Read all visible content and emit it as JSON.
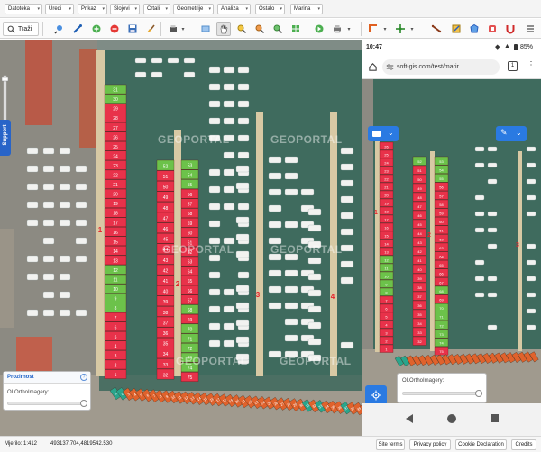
{
  "menubar": {
    "items": [
      {
        "label": "Datoteka"
      },
      {
        "label": "Uredi"
      },
      {
        "label": "Prikaz"
      },
      {
        "label": "Slojevi"
      },
      {
        "label": "Crtali"
      },
      {
        "label": "Geometrije"
      },
      {
        "label": "Analiza"
      },
      {
        "label": "Ostalo"
      },
      {
        "label": "Marina"
      }
    ]
  },
  "toolbar": {
    "search_label": "Traži",
    "icons": [
      "zoom-in-icon",
      "pencil-icon",
      "plus-icon",
      "minus-icon",
      "save-icon",
      "brush-icon",
      "print-icon",
      "rectangle-icon",
      "pan-icon",
      "search-zoom-icon",
      "zoom-out-icon",
      "zoom-extent-icon",
      "layers-icon",
      "arrow-icon",
      "printer-icon",
      "corner-icon",
      "crosshair-icon",
      "line-icon",
      "select-icon",
      "polygon-icon",
      "undo-icon",
      "redo-icon",
      "menu-icon"
    ]
  },
  "support_label": "Support",
  "map": {
    "watermark": "GEOPORTAL",
    "pier_labels": [
      "1",
      "2",
      "3",
      "4"
    ],
    "pier1_berths": [
      "31",
      "30",
      "29",
      "28",
      "27",
      "26",
      "25",
      "24",
      "23",
      "22",
      "21",
      "20",
      "19",
      "18",
      "17",
      "16",
      "15",
      "14",
      "13",
      "12",
      "11",
      "10",
      "9",
      "8",
      "7",
      "6",
      "5",
      "4",
      "3",
      "2",
      "1"
    ],
    "pier1_status": [
      "g",
      "g",
      "r",
      "r",
      "r",
      "r",
      "r",
      "r",
      "r",
      "r",
      "r",
      "r",
      "r",
      "r",
      "r",
      "r",
      "r",
      "r",
      "r",
      "g",
      "g",
      "g",
      "g",
      "g",
      "r",
      "r",
      "r",
      "r",
      "r",
      "r",
      "r"
    ],
    "pier2a_berths": [
      "52",
      "51",
      "50",
      "49",
      "48",
      "47",
      "46",
      "45",
      "44",
      "43",
      "42",
      "41",
      "40",
      "39",
      "38",
      "37",
      "36",
      "35",
      "34",
      "33",
      "32"
    ],
    "pier2a_status": [
      "g",
      "r",
      "r",
      "r",
      "r",
      "r",
      "r",
      "r",
      "r",
      "r",
      "r",
      "r",
      "r",
      "r",
      "r",
      "r",
      "r",
      "r",
      "r",
      "r",
      "r"
    ],
    "pier2b_berths": [
      "53",
      "54",
      "55",
      "56",
      "57",
      "58",
      "59",
      "60",
      "61",
      "62",
      "63",
      "64",
      "65",
      "66",
      "67",
      "68",
      "69",
      "70",
      "71",
      "72",
      "73",
      "74",
      "75"
    ],
    "pier2b_status": [
      "g",
      "g",
      "g",
      "r",
      "r",
      "r",
      "r",
      "r",
      "r",
      "r",
      "r",
      "r",
      "r",
      "r",
      "r",
      "g",
      "r",
      "g",
      "g",
      "g",
      "g",
      "g",
      "r"
    ],
    "bottom_row": [
      "1",
      "2",
      "3",
      "4",
      "5",
      "6",
      "7",
      "8",
      "9",
      "10",
      "11",
      "12",
      "13",
      "14",
      "15",
      "16",
      "17",
      "18",
      "19",
      "20",
      "21",
      "22",
      "23",
      "24",
      "25",
      "26",
      "27",
      "28",
      "29",
      "30",
      "31",
      "32",
      "33",
      "34",
      "35",
      "36",
      "37",
      "38",
      "39",
      "40"
    ],
    "bottom_status": [
      "t",
      "t",
      "o",
      "o",
      "o",
      "o",
      "o",
      "o",
      "o",
      "o",
      "o",
      "o",
      "o",
      "o",
      "o",
      "o",
      "o",
      "o",
      "o",
      "o",
      "o",
      "o",
      "o",
      "o",
      "o",
      "o",
      "o",
      "o",
      "o",
      "o",
      "t",
      "o",
      "t",
      "o",
      "o",
      "o",
      "t",
      "o",
      "o",
      "o"
    ]
  },
  "panel": {
    "title": "Prozirnost",
    "layer": "OI.OrthoImagery:"
  },
  "status_bar": {
    "scale": "Mjerilo: 1:412",
    "coords": "493137.704,4819542.530",
    "links": [
      "Site terms",
      "Privacy policy",
      "Cookie Declaration",
      "Credits"
    ]
  },
  "phone": {
    "time": "10:47",
    "battery": "85%",
    "url": "soft-gis.com/test/marir",
    "tabs_count": "1",
    "panel_layer": "OI.OrthoImagery:",
    "pier_labels": [
      "1",
      "2",
      "3"
    ]
  },
  "colors": {
    "occupied": "#e8324a",
    "free": "#6cc24a",
    "pier": "#d8c9a4",
    "water": "#3f6b5e",
    "bottom_orange": "#e0622c",
    "bottom_teal": "#2aa58c",
    "accent": "#2a7ae2"
  }
}
